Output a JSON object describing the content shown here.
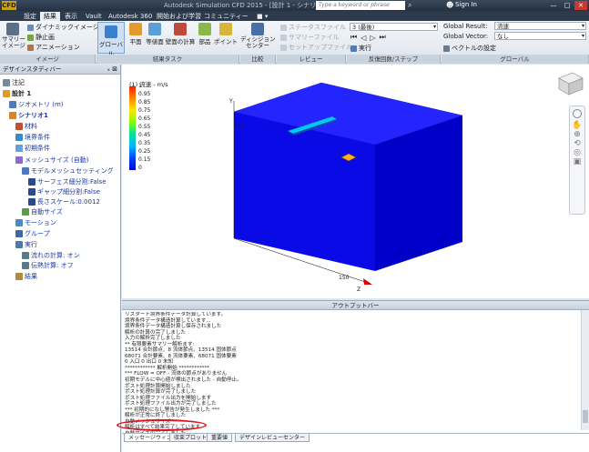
{
  "titlebar": {
    "logo": "CFD",
    "title": "Autodesk Simulation CFD 2015 - [設計 1 - シナリオ1]",
    "search_placeholder": "Type a keyword or phrase",
    "signin": "Sign In",
    "buttons": [
      "—",
      "□",
      "✕"
    ]
  },
  "tabs": [
    "設定",
    "結果",
    "表示",
    "Vault",
    "Autodesk 360",
    "開始および学習",
    "コミュニティー",
    "■ ▾"
  ],
  "active_tab": 1,
  "ribbon": {
    "image_panel": {
      "label": "イメージ",
      "summary_btn": "サマリー\nイメージ",
      "items": [
        "ダイナミックイメージ",
        "静止画",
        "アニメーション"
      ]
    },
    "result_tasks": {
      "label": "結果タスク",
      "buttons": [
        "グローバル",
        "平面",
        "等値面",
        "壁面の計算",
        "部品",
        "ポイント"
      ]
    },
    "compare": {
      "label": "比較",
      "button": "ディシジョン\nセンター"
    },
    "review": {
      "label": "レビュー",
      "items": [
        "ステータスファイル",
        "サマリーファイル",
        "セットアップファイル"
      ]
    },
    "iteration": {
      "label": "反復回数/ステップ",
      "select": "3 (最後)",
      "run": "実行"
    },
    "global": {
      "label": "グローバル",
      "result_label": "Global Result:",
      "result_value": "流速",
      "vector_label": "Global Vector:",
      "vector_value": "なし",
      "vector_settings": "ベクトルの設定"
    }
  },
  "left": {
    "header": "デザインスタディバー",
    "tree": [
      {
        "label": "注記",
        "indent": 0,
        "color": "#1a1a1a"
      },
      {
        "label": "設計 1",
        "indent": 0,
        "color": "#1a1a1a",
        "bold": true
      },
      {
        "label": "ジオメトリ (m)",
        "indent": 1,
        "color": "#1536a8"
      },
      {
        "label": "シナリオ1",
        "indent": 1,
        "color": "#1536a8",
        "bold": true
      },
      {
        "label": "材料",
        "indent": 2,
        "color": "#1536a8"
      },
      {
        "label": "境界条件",
        "indent": 2,
        "color": "#1536a8"
      },
      {
        "label": "初期条件",
        "indent": 2,
        "color": "#1536a8"
      },
      {
        "label": "メッシュサイズ (自動)",
        "indent": 2,
        "color": "#1536a8"
      },
      {
        "label": "モデルメッシュセッティング",
        "indent": 3,
        "color": "#1536a8"
      },
      {
        "label": "サーフェス細分割:False",
        "indent": 4,
        "color": "#1536a8"
      },
      {
        "label": "ギャップ細分割:False",
        "indent": 4,
        "color": "#1536a8"
      },
      {
        "label": "長さスケール:0.0012",
        "indent": 4,
        "color": "#1536a8"
      },
      {
        "label": "自動サイズ",
        "indent": 3,
        "color": "#1536a8"
      },
      {
        "label": "モーション",
        "indent": 2,
        "color": "#1536a8"
      },
      {
        "label": "グループ",
        "indent": 2,
        "color": "#1536a8"
      },
      {
        "label": "実行",
        "indent": 2,
        "color": "#1536a8"
      },
      {
        "label": "流れの計算: オン",
        "indent": 3,
        "color": "#1536a8"
      },
      {
        "label": "伝熱計算: オフ",
        "indent": 3,
        "color": "#1536a8"
      },
      {
        "label": "結果",
        "indent": 2,
        "color": "#1536a8"
      }
    ]
  },
  "legend": {
    "title": "(1) 流速 - m/s",
    "ticks": [
      "1",
      "0.95",
      "0.85",
      "0.75",
      "0.65",
      "0.55",
      "0.45",
      "0.35",
      "0.25",
      "0.15",
      "0"
    ]
  },
  "viewport": {
    "axis_y": "Y",
    "axis_z": "Z",
    "tick_150": "150",
    "tick_120": "120"
  },
  "output": {
    "header": "アウトプットバー",
    "lines": [
      "リスタート境界条件データ計算しています。",
      "境界条件データ構造計算しています...",
      "境界条件データ構造計算し保存されました",
      "解析の計算の完了しました",
      "入力の解析完了しました",
      "** 有限要素サマリー解析ます:",
      "  13514 合計節点、8 流体節点、13514 固体節点",
      "  68071 合計要素、8 流体要素、68071 固体要素",
      "  0 入口  0 出口  0 未知",
      "************ 解析開始 ************",
      "*** FLOW = OFF - 流体の節点がありません",
      "初期モデルに中心値が検出されました - 自動停止。",
      "ポスト処理計算開始しました",
      "ポスト処理計算が完了しました",
      "ポスト処理ファイル出力を開始します",
      "ポスト処理ファイル出力が完了しました",
      "*** 初期的になし警告が発生しました ***",
      "解析が正常に終了しました",
      "自動メッシュサイズ",
      "解析はすべて結果完了しています",
      "自動サイズの完了しました。"
    ],
    "tabs": [
      "メッセージウィンドウ",
      "収束プロット",
      "重要値",
      "デザインレビューセンター"
    ],
    "active_tab": 0
  }
}
